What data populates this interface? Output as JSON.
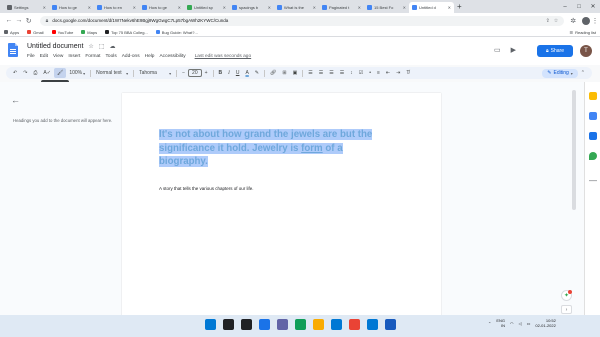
{
  "browser": {
    "tabs": [
      {
        "label": "Settings",
        "color": "#5f6368",
        "active": false
      },
      {
        "label": "How to ge",
        "color": "#4285f4",
        "active": false
      },
      {
        "label": "How to en",
        "color": "#4285f4",
        "active": false
      },
      {
        "label": "How to ge",
        "color": "#4285f4",
        "active": false
      },
      {
        "label": "Untitled sp",
        "color": "#34a853",
        "active": false
      },
      {
        "label": "spacings b",
        "color": "#4285f4",
        "active": false
      },
      {
        "label": "What is the",
        "color": "#4285f4",
        "active": false
      },
      {
        "label": "Paginated t",
        "color": "#4285f4",
        "active": false
      },
      {
        "label": "15 Best Fo",
        "color": "#4285f4",
        "active": false
      },
      {
        "label": "Untitled d",
        "color": "#4285f4",
        "active": true
      }
    ],
    "url": "docs.google.com/document/d/1W7Nekv6hE9Bgj9WgGwgC7Lp57bgAWh2KYWC/Cunda",
    "bookmarks": [
      {
        "label": "Apps",
        "color": "#5f6368"
      },
      {
        "label": "Gmail",
        "color": "#ea4335"
      },
      {
        "label": "YouTube",
        "color": "#ff0000"
      },
      {
        "label": "Maps",
        "color": "#34a853"
      },
      {
        "label": "Top 75 BBA Colleg...",
        "color": "#202124"
      },
      {
        "label": "Bug Guide: What?...",
        "color": "#4285f4"
      }
    ],
    "reading_list": "Reading list"
  },
  "docs": {
    "title": "Untitled document",
    "menus": [
      "File",
      "Edit",
      "View",
      "Insert",
      "Format",
      "Tools",
      "Add-ons",
      "Help",
      "Accessibility"
    ],
    "last_edit": "Last edit was seconds ago",
    "share_label": "Share",
    "avatar_letter": "T",
    "toolbar": {
      "zoom": "100%",
      "style": "Normal text",
      "font": "Tahoma",
      "font_size": "20",
      "minus": "−",
      "plus": "+",
      "bold": "B",
      "italic": "I",
      "underline": "U",
      "text_color": "A",
      "editing": "Editing"
    },
    "tooltip": "Paint format",
    "outline_hint": "Headings you add to the document will appear here.",
    "heading_before": "It's not about how grand the jewels are but the significance it hold. Jewelry is ",
    "heading_link": "form",
    "heading_after": " of a biography.",
    "body_text": "A story that tells the various chapters of our life."
  },
  "taskbar": {
    "icons": [
      {
        "name": "windows-start-icon",
        "color": "#0078d4"
      },
      {
        "name": "search-icon",
        "color": "#202124"
      },
      {
        "name": "task-view-icon",
        "color": "#202124"
      },
      {
        "name": "widgets-icon",
        "color": "#1a73e8"
      },
      {
        "name": "chat-icon",
        "color": "#6264a7"
      },
      {
        "name": "edge-icon",
        "color": "#0f9d58"
      },
      {
        "name": "file-explorer-icon",
        "color": "#f9ab00"
      },
      {
        "name": "store-icon",
        "color": "#0078d4"
      },
      {
        "name": "chrome-icon",
        "color": "#ea4335"
      },
      {
        "name": "outlook-icon",
        "color": "#0078d4"
      },
      {
        "name": "word-icon",
        "color": "#185abd"
      }
    ],
    "lang_top": "ENG",
    "lang_bottom": "IN",
    "time": "10:52",
    "date": "02-01-2022"
  }
}
